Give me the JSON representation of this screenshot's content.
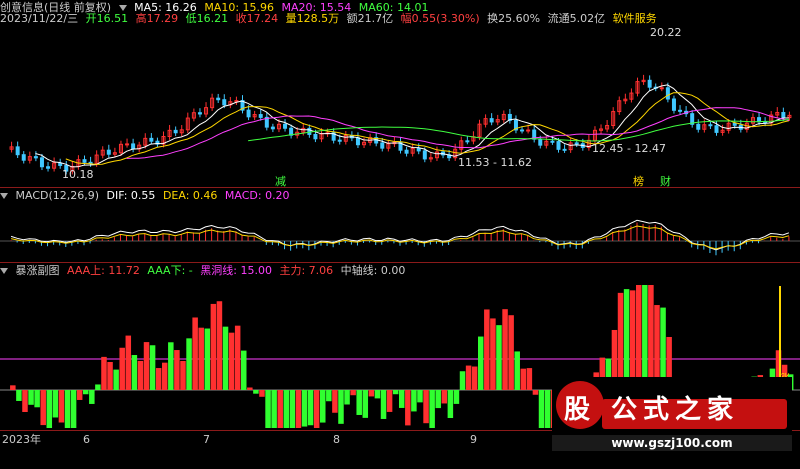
{
  "header": {
    "title": "创意信息(日线 前复权)",
    "ma": [
      {
        "label": "MA5: 16.26",
        "color": "#ffffff"
      },
      {
        "label": "MA10: 15.96",
        "color": "#ffd700"
      },
      {
        "label": "MA20: 15.54",
        "color": "#ff40ff"
      },
      {
        "label": "MA60: 14.01",
        "color": "#40ff40"
      }
    ]
  },
  "quote": {
    "date": "2023/11/22/三",
    "items": [
      {
        "label": "开16.51",
        "color": "#40ff40"
      },
      {
        "label": "高17.29",
        "color": "#ff4040"
      },
      {
        "label": "低16.21",
        "color": "#40ff40"
      },
      {
        "label": "收17.24",
        "color": "#ff4040"
      },
      {
        "label": "量128.5万",
        "color": "#ffd700"
      },
      {
        "label": "额21.7亿",
        "color": "#cccccc"
      },
      {
        "label": "幅0.55(3.30%)",
        "color": "#ff4040"
      },
      {
        "label": "换25.60%",
        "color": "#cccccc"
      },
      {
        "label": "流通5.02亿",
        "color": "#cccccc"
      },
      {
        "label": "软件服务",
        "color": "#ffd700"
      }
    ]
  },
  "kline": {
    "price_high": "20.22",
    "price_low": "10.18",
    "range1": "11.53 - 11.62",
    "range2": "12.45 - 12.47",
    "badges": [
      {
        "text": "减",
        "color": "#40ff40"
      },
      {
        "text": "榜",
        "color": "#ffd700"
      },
      {
        "text": "财",
        "color": "#40ff40"
      }
    ]
  },
  "macd": {
    "title": "MACD(12,26,9)",
    "dif": "DIF: 0.55",
    "dea": "DEA: 0.46",
    "macd": "MACD: 0.20"
  },
  "sub": {
    "title": "暴涨副图",
    "items": [
      {
        "label": "AAA上: 11.72",
        "color": "#ff4040"
      },
      {
        "label": "AAA下: -",
        "color": "#40ff40"
      },
      {
        "label": "黑洞线: 15.00",
        "color": "#ff40ff"
      },
      {
        "label": "主力: 7.06",
        "color": "#ff4040"
      },
      {
        "label": "中轴线: 0.00",
        "color": "#cccccc"
      }
    ],
    "limit_up": "涨停"
  },
  "axis": {
    "labels": [
      "2023年",
      "6",
      "7",
      "8",
      "9",
      "10"
    ]
  },
  "watermark": {
    "logo_text": "股 公式之家",
    "url": "www.gszj100.com"
  },
  "colors": {
    "up": "#ff3030",
    "down": "#30ff30",
    "bg": "#000000"
  }
}
